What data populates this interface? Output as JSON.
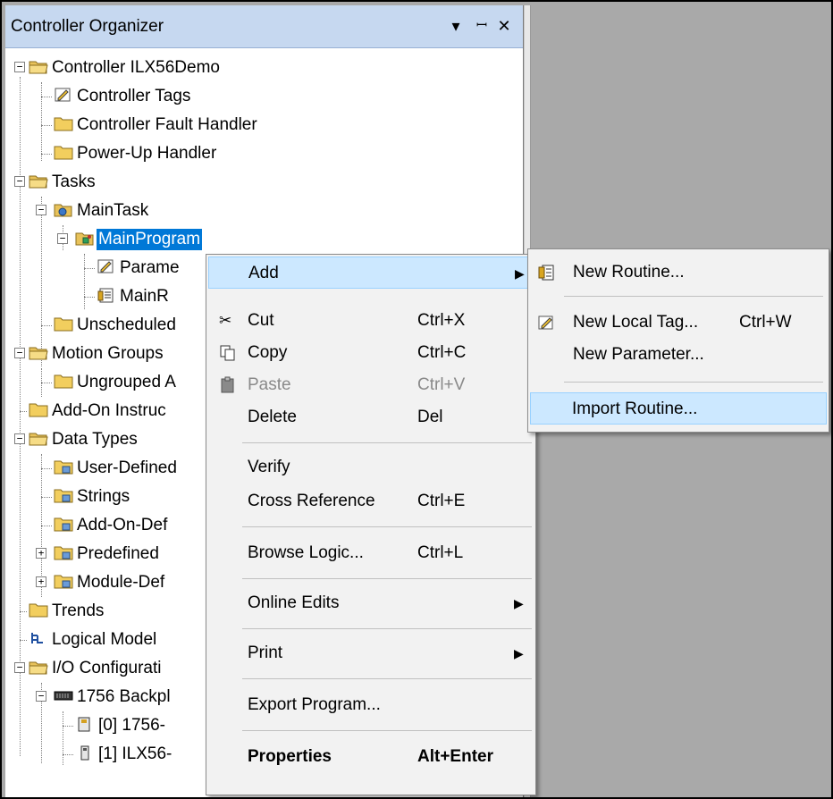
{
  "organizer": {
    "title": "Controller Organizer",
    "pin_icon": "pin-icon",
    "menu_icon": "chevron-down-icon",
    "close_icon": "close-icon"
  },
  "tree": {
    "controller": "Controller ILX56Demo",
    "controller_tags": "Controller Tags",
    "fault_handler": "Controller Fault Handler",
    "powerup_handler": "Power-Up Handler",
    "tasks": "Tasks",
    "main_task": "MainTask",
    "main_program": "MainProgram",
    "parameters": "Parame",
    "main_routine": "MainR",
    "unscheduled": "Unscheduled",
    "motion_groups": "Motion Groups",
    "ungrouped": "Ungrouped A",
    "addon_instructions": "Add-On Instruc",
    "data_types": "Data Types",
    "user_defined": "User-Defined",
    "strings": "Strings",
    "addon_defined": "Add-On-Def",
    "predefined": "Predefined",
    "module_defined": "Module-Def",
    "trends": "Trends",
    "logical_model": "Logical Model",
    "io_config": "I/O Configurati",
    "backplane": "1756 Backpl",
    "slot0": "[0] 1756-",
    "slot1": "[1] ILX56-"
  },
  "context_menu": {
    "add": "Add",
    "cut": "Cut",
    "cut_sc": "Ctrl+X",
    "copy": "Copy",
    "copy_sc": "Ctrl+C",
    "paste": "Paste",
    "paste_sc": "Ctrl+V",
    "delete": "Delete",
    "delete_sc": "Del",
    "verify": "Verify",
    "cross_ref": "Cross Reference",
    "cross_ref_sc": "Ctrl+E",
    "browse": "Browse Logic...",
    "browse_sc": "Ctrl+L",
    "online_edits": "Online Edits",
    "print": "Print",
    "export": "Export Program...",
    "properties": "Properties",
    "properties_sc": "Alt+Enter"
  },
  "submenu": {
    "new_routine": "New Routine...",
    "new_local_tag": "New Local Tag...",
    "new_local_tag_sc": "Ctrl+W",
    "new_parameter": "New Parameter...",
    "import_routine": "Import Routine..."
  },
  "colors": {
    "selection": "#0078d7",
    "hover": "#cce8ff",
    "workspace": "#a9a9a9",
    "titlebar": "#c6d8f0"
  }
}
